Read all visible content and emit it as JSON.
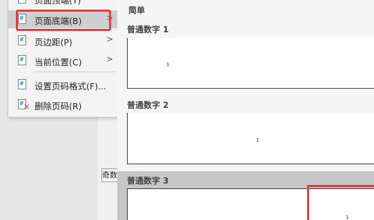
{
  "menu": {
    "items": [
      {
        "label": "页面顶端(T)",
        "has_submenu": true
      },
      {
        "label": "页面底端(B)",
        "has_submenu": true,
        "highlighted": true
      },
      {
        "label": "页边距(P)",
        "has_submenu": true
      },
      {
        "label": "当前位置(C)",
        "has_submenu": true
      },
      {
        "label": "设置页码格式(F)...",
        "has_submenu": false
      },
      {
        "label": "删除页码(R)",
        "has_submenu": false
      }
    ],
    "arrow_glyph": ">"
  },
  "background": {
    "tab_label": "奇数"
  },
  "gallery": {
    "section_title": "简单",
    "options": [
      {
        "label": "普通数字 1",
        "page_number": "1"
      },
      {
        "label": "普通数字 2",
        "page_number": "1"
      },
      {
        "label": "普通数字 3",
        "page_number": "1"
      }
    ]
  },
  "colors": {
    "highlight_border": "#e03c3c",
    "icon_accent": "#3b83c4"
  }
}
